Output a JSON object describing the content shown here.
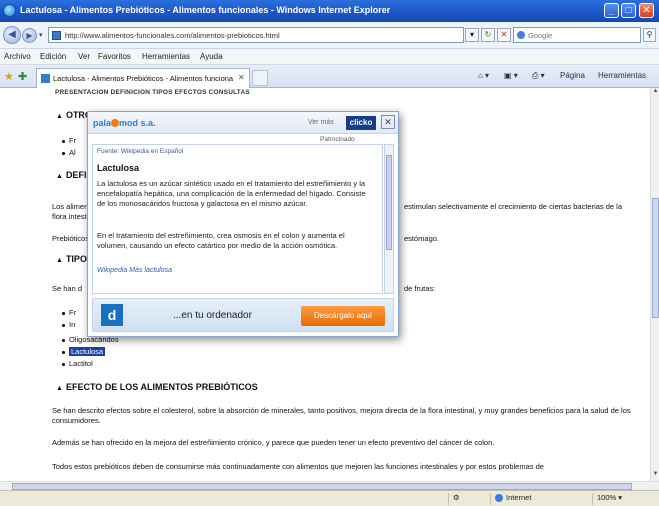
{
  "window": {
    "title": "Lactulosa - Alimentos Prebióticos - Alimentos funcionales - Windows Internet Explorer"
  },
  "address": {
    "url": "http://www.alimentos-funcionales.com/alimentos-prebioticos.html",
    "search_placeholder": "Google"
  },
  "menu": [
    "Archivo",
    "Edición",
    "Ver",
    "Favoritos",
    "Herramientas",
    "Ayuda"
  ],
  "tab": {
    "label": "Lactulosa - Alimentos Prebióticos - Alimentos funcionales"
  },
  "toolbar": {
    "page_label": "Página",
    "tools_label": "Herramientas"
  },
  "page": {
    "navline": "PRESENTACION  DEFINICION  TIPOS  EFECTOS  CONSULTAS",
    "h_otros": "OTROS",
    "bul_1": "Fr",
    "bul_2": "Al",
    "h_def": "DEFINICION",
    "def_left": "Los alimentos prebióticos son",
    "def_right": "estimulan selectivamente el crecimiento de ciertas bacterias de la",
    "def_left2": "flora intestinal",
    "prebio_left": "Prebióticos",
    "prebio_right": "estómago.",
    "h_tipos": "TIPOS",
    "tipos_left": "Se han d",
    "tipos_right": "de frutas:",
    "tipo_items": [
      "Fr",
      "In",
      "Oligosacáridos",
      "Lactulosa",
      "Lactitol"
    ],
    "h_efecto": "EFECTO DE LOS ALIMENTOS PREBIÓTICOS",
    "p1": "Se han descrito efectos sobre el colesterol, sobre la absorción de minerales, tanto positivos, mejora directa de la flora intestinal, y muy grandes beneficios para la salud de los consumidores.",
    "p2": "Además se han ofrecido en la mejora del estreñimiento crónico, y parece que pueden tener un efecto preventivo del cáncer de colon.",
    "p3": "Todos estos prebióticos deben de consumirse más continuadamente con alimentos que mejoren las funciones intestinales y por estos problemas de"
  },
  "popup": {
    "brand": "pala",
    "brand_suffix": "mod s.a.",
    "ver_label": "Ver más",
    "click_label": "clicko",
    "powered": "Patrocinado",
    "source": "Fuente: Wikipedia en Español",
    "term": "Lactulosa",
    "def1": "La lactulosa es un azúcar sintético usado en el tratamiento del estreñimiento y la encefalopatía hepática, una complicación de la enfermedad del hígado. Consiste de los monosacáridos fructosa y galactosa en el mismo azúcar.",
    "def2": "En el tratamiento del estreñimiento, crea osmosis en el colon y aumenta el volumen, causando un efecto catártico por medio de la acción osmótica.",
    "more": "Wikipedia Más lactulosa",
    "banner_text": "...en tu ordenador",
    "download_label": "Descárgalo aquí"
  },
  "status": {
    "zone": "Internet",
    "zoom": "100%"
  }
}
